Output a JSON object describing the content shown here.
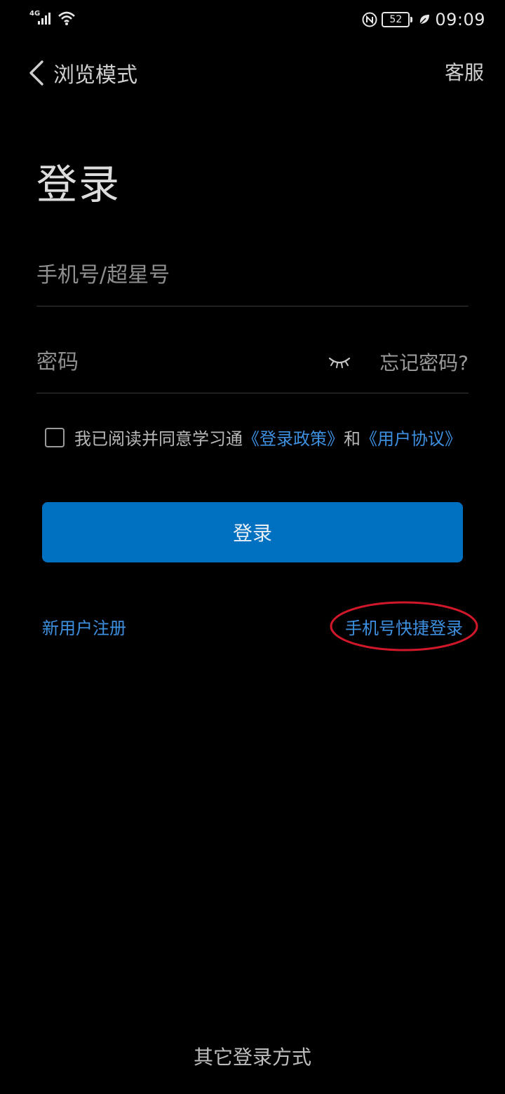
{
  "status_bar": {
    "network": "4G",
    "battery": "52",
    "time": "09:09",
    "icons": [
      "signal-bars-icon",
      "wifi-icon",
      "nfc-icon",
      "battery-icon",
      "leaf-icon"
    ]
  },
  "nav": {
    "back_label": "浏览模式",
    "support_label": "客服"
  },
  "title": "登录",
  "fields": {
    "account_placeholder": "手机号/超星号",
    "account_value": "",
    "password_placeholder": "密码",
    "password_value": "",
    "forgot_label": "忘记密码?"
  },
  "agreement": {
    "checked": false,
    "prefix": "我已阅读并同意学习通",
    "policy_link": "《登录政策》",
    "conjunction": "和",
    "terms_link": "《用户协议》"
  },
  "login_button": "登录",
  "links": {
    "register": "新用户注册",
    "quick_login": "手机号快捷登录"
  },
  "footer": {
    "other_login": "其它登录方式"
  },
  "colors": {
    "background": "#000000",
    "primary_button": "#0070c0",
    "link": "#3d8fe0",
    "annotation_ring": "#d0182a"
  }
}
